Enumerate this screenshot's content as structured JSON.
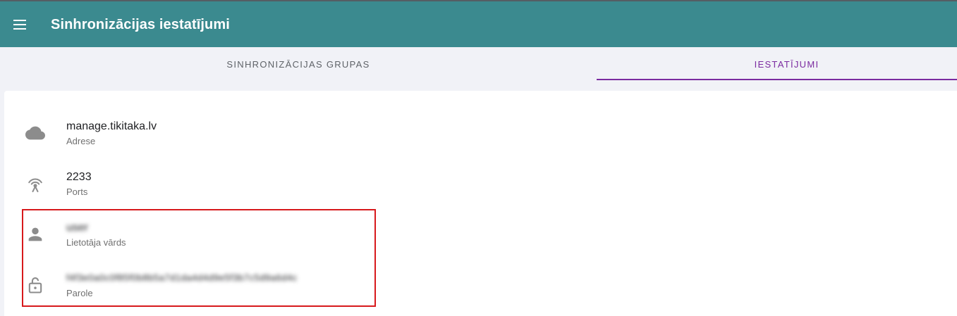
{
  "appbar": {
    "title": "Sinhronizācijas iestatījumi",
    "menu_icon": "menu-icon"
  },
  "tabs": [
    {
      "label": "SINHRONIZĀCIJAS GRUPAS",
      "active": false
    },
    {
      "label": "IESTATĪJUMI",
      "active": true
    }
  ],
  "settings": {
    "items": [
      {
        "icon": "cloud-icon",
        "value": "manage.tikitaka.lv",
        "label": "Adrese"
      },
      {
        "icon": "antenna-icon",
        "value": "2233",
        "label": "Ports"
      },
      {
        "icon": "person-icon",
        "value": "user",
        "label": "Lietotāja vārds"
      },
      {
        "icon": "lock-open-icon",
        "value": "f4f3e0a0c0f85f0b8b5a7d1da4d4d9e5f3b7c5d9a6d4c",
        "label": "Parole"
      }
    ]
  },
  "colors": {
    "appbar": "#3b8a8f",
    "accent": "#7b2ba0",
    "highlight": "#d7191c"
  }
}
